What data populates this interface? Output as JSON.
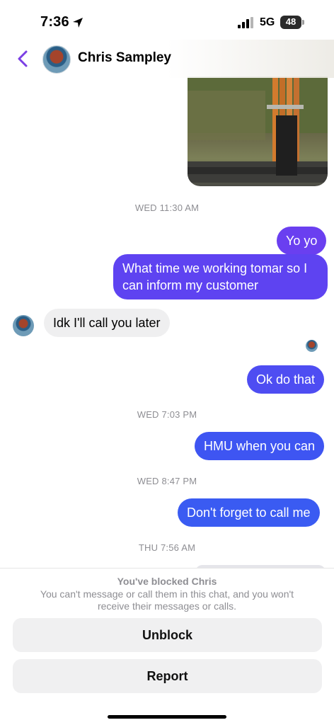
{
  "status_bar": {
    "time": "7:36",
    "network": "5G",
    "battery": "48"
  },
  "header": {
    "contact_name": "Chris Sampley"
  },
  "messages": [
    {
      "timestamp": "WED 11:30 AM"
    },
    {
      "text": "Yo yo"
    },
    {
      "text_line1": "What time we working tomar so I",
      "text_line2": "can inform my customer"
    },
    {
      "text": "Idk I'll call you later"
    },
    {
      "text": "Ok do that"
    },
    {
      "timestamp": "WED 7:03 PM"
    },
    {
      "text": "HMU when you can"
    },
    {
      "timestamp": "WED 8:47 PM"
    },
    {
      "text": "Don't forget to call me"
    },
    {
      "timestamp": "THU 7:56 AM"
    }
  ],
  "blocked": {
    "title": "You've blocked Chris",
    "description": "You can't message or call them in this chat, and you won't receive their messages or calls.",
    "unblock_label": "Unblock",
    "report_label": "Report"
  },
  "colors": {
    "accent": "#7b3fe4",
    "bubble_purple": "#6b3ff0",
    "bubble_blue": "#3b5bf2",
    "incoming_bubble": "#efeff0"
  },
  "icons": [
    "location-arrow-icon",
    "signal-bars-icon",
    "battery-icon",
    "chevron-left-icon"
  ]
}
